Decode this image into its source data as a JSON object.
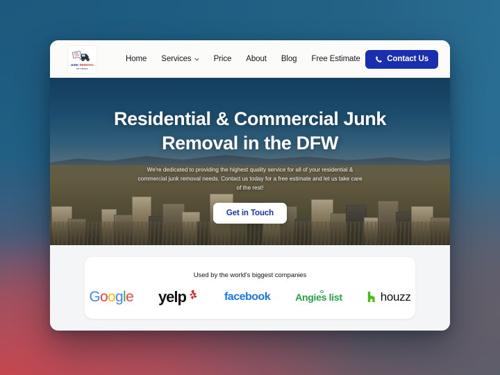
{
  "desktop": {
    "wallpaper_colors": [
      "#1d587d",
      "#2a6f95",
      "#5c6b7e",
      "#b9505c",
      "#585e6a"
    ]
  },
  "browser": {
    "nav": {
      "logo": {
        "name": "junk-removal-of-texas-logo",
        "line1_part1": "JUNK ",
        "line1_part2": "REMOVAL",
        "line2": "OF TEXAS"
      },
      "links": [
        {
          "label": "Home",
          "has_chevron": false
        },
        {
          "label": "Services",
          "has_chevron": true
        },
        {
          "label": "Price",
          "has_chevron": false
        },
        {
          "label": "About",
          "has_chevron": false
        },
        {
          "label": "Blog",
          "has_chevron": false
        },
        {
          "label": "Free Estimate",
          "has_chevron": false
        }
      ],
      "contact_button": {
        "label": "Contact Us",
        "icon": "phone-icon",
        "bg_color": "#1a2fb0",
        "text_color": "#ffffff"
      }
    },
    "hero": {
      "title": "Residential & Commercial Junk Removal in the DFW",
      "subtitle": "We're dedicated to providing the highest quality service for all of your residential & commercial junk removal needs. Contact us today for a free estimate and let us take care of the rest!",
      "cta_label": "Get in Touch",
      "cta_text_color": "#1a2fb0",
      "background_description": "Photo of a large pile of discarded appliances and furniture in a desert landscape under a blue sky"
    },
    "brands": {
      "title": "Used by the world's biggest companies",
      "logos": [
        {
          "name": "google-logo",
          "text": "Google",
          "letters": [
            "G",
            "o",
            "o",
            "g",
            "l",
            "e"
          ],
          "colors": [
            "#4285F4",
            "#EA4335",
            "#FBBC05",
            "#4285F4",
            "#34A853",
            "#EA4335"
          ]
        },
        {
          "name": "yelp-logo",
          "text": "yelp",
          "color": "#111111",
          "accent_color": "#D32323"
        },
        {
          "name": "facebook-logo",
          "text": "facebook",
          "color": "#1877F2"
        },
        {
          "name": "angies-list-logo",
          "text": "Angies list",
          "color": "#24A148"
        },
        {
          "name": "houzz-logo",
          "text": "houzz",
          "color": "#111111",
          "accent_color": "#4DBC15"
        }
      ]
    }
  }
}
